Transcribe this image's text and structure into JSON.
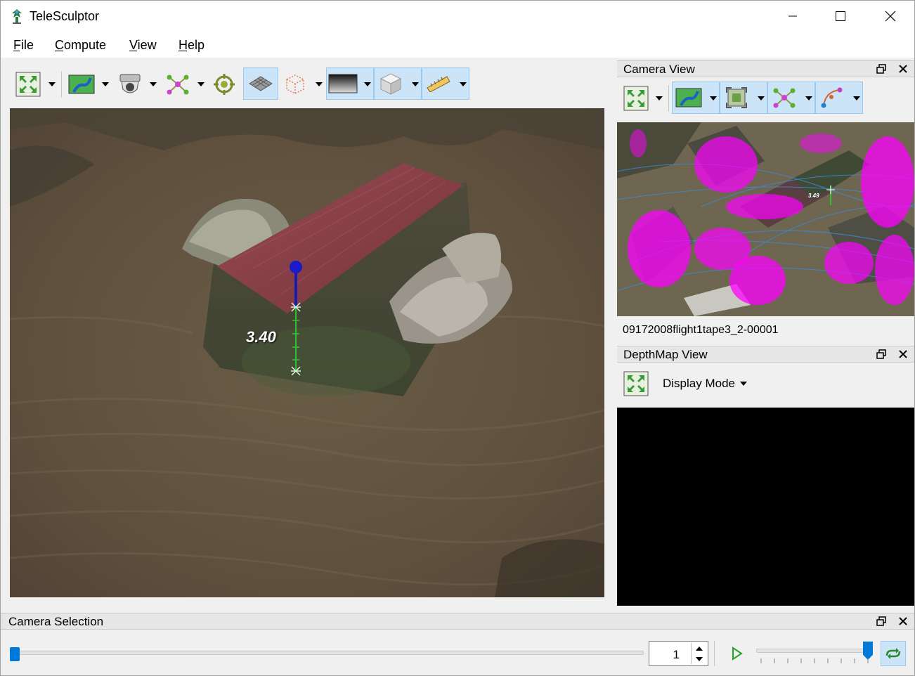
{
  "window": {
    "title": "TeleSculptor"
  },
  "menu": {
    "file": "File",
    "compute": "Compute",
    "view": "View",
    "help": "Help"
  },
  "main_toolbar": {
    "buttons": [
      "reset-view-icon",
      "image-layer-icon",
      "camera-icon",
      "landmarks-icon",
      "ground-target-icon",
      "ground-plane-icon",
      "roi-box-icon",
      "depth-map-icon",
      "volume-cube-icon",
      "ruler-icon"
    ],
    "active": [
      "ground-plane-icon",
      "depth-map-icon",
      "volume-cube-icon",
      "ruler-icon"
    ]
  },
  "world_view": {
    "measurement_label": "3.40"
  },
  "camera_view": {
    "title": "Camera View",
    "frame_name": "09172008flight1tape3_2-00001",
    "measurement_label": "3.49",
    "point_color": "#ff00ff",
    "track_color": "#3c8ad8"
  },
  "depthmap_view": {
    "title": "DepthMap View",
    "display_mode_label": "Display Mode"
  },
  "camera_selection": {
    "title": "Camera Selection",
    "frame_value": "1",
    "frame_slider_position": 0.0,
    "speed_slider_position": 1.0
  },
  "colors": {
    "accent": "#0078d7",
    "active_button": "#cce4f7",
    "measure_line": "#2a2ad8",
    "measure_tick": "#30c030",
    "roof": "#8a3c44"
  }
}
